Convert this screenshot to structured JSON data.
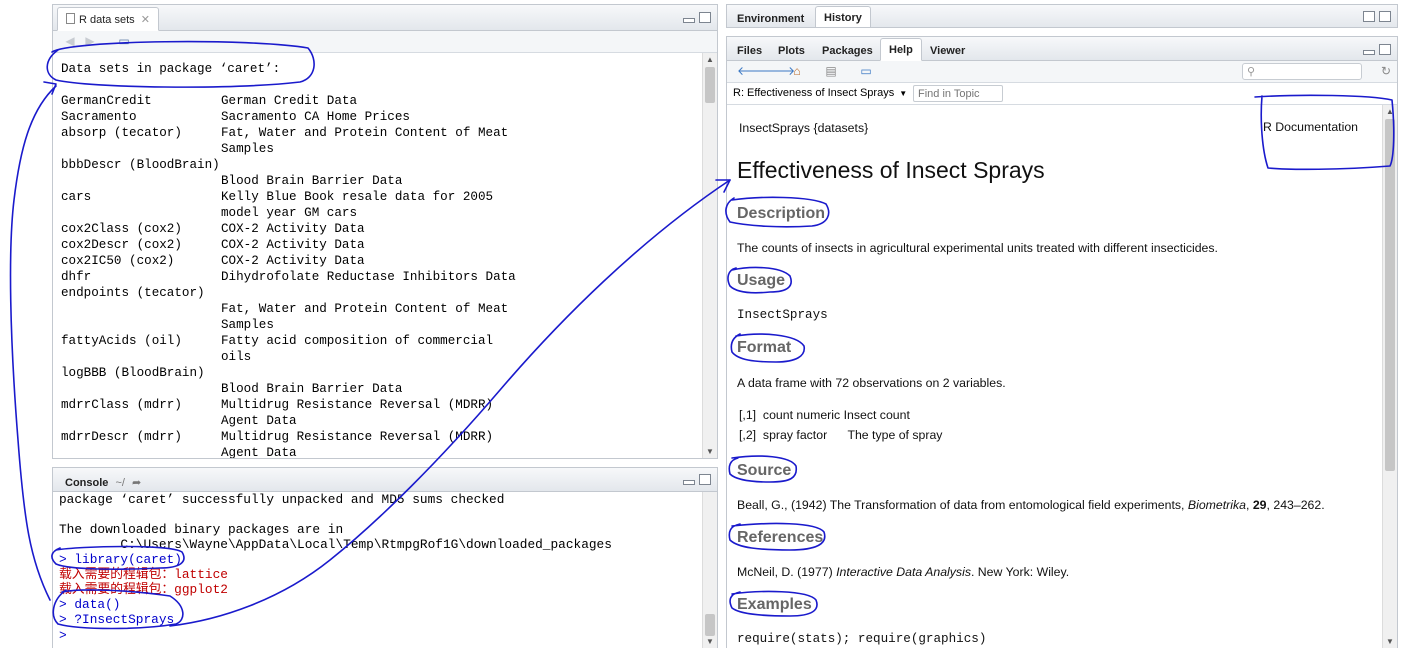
{
  "source_pane": {
    "tab_label": "R data sets",
    "heading": "Data sets in package ‘caret’:",
    "rows": [
      [
        "GermanCredit",
        "German Credit Data"
      ],
      [
        "Sacramento",
        "Sacramento CA Home Prices"
      ],
      [
        "absorp (tecator)",
        "Fat, Water and Protein Content of Meat"
      ],
      [
        "",
        "Samples"
      ],
      [
        "bbbDescr (BloodBrain)",
        ""
      ],
      [
        "",
        "Blood Brain Barrier Data"
      ],
      [
        "cars",
        "Kelly Blue Book resale data for 2005"
      ],
      [
        "",
        "model year GM cars"
      ],
      [
        "cox2Class (cox2)",
        "COX-2 Activity Data"
      ],
      [
        "cox2Descr (cox2)",
        "COX-2 Activity Data"
      ],
      [
        "cox2IC50 (cox2)",
        "COX-2 Activity Data"
      ],
      [
        "dhfr",
        "Dihydrofolate Reductase Inhibitors Data"
      ],
      [
        "endpoints (tecator)",
        ""
      ],
      [
        "",
        "Fat, Water and Protein Content of Meat"
      ],
      [
        "",
        "Samples"
      ],
      [
        "fattyAcids (oil)",
        "Fatty acid composition of commercial"
      ],
      [
        "",
        "oils"
      ],
      [
        "logBBB (BloodBrain)",
        ""
      ],
      [
        "",
        "Blood Brain Barrier Data"
      ],
      [
        "mdrrClass (mdrr)",
        "Multidrug Resistance Reversal (MDRR)"
      ],
      [
        "",
        "Agent Data"
      ],
      [
        "mdrrDescr (mdrr)",
        "Multidrug Resistance Reversal (MDRR)"
      ],
      [
        "",
        "Agent Data"
      ]
    ]
  },
  "console": {
    "tab_label": "Console",
    "path": "~/",
    "lines": [
      {
        "text": "package ‘caret’ successfully unpacked and MD5 sums checked",
        "color": "#000000"
      },
      {
        "text": "",
        "color": "#000000"
      },
      {
        "text": "The downloaded binary packages are in",
        "color": "#000000"
      },
      {
        "text": "        C:\\Users\\Wayne\\AppData\\Local\\Temp\\RtmpgRof1G\\downloaded_packages",
        "color": "#000000"
      },
      {
        "text": "> library(caret)",
        "color": "#0000cc"
      },
      {
        "text": "载入需要的程辑包：lattice",
        "color": "#c00000"
      },
      {
        "text": "载入需要的程辑包：ggplot2",
        "color": "#c00000"
      },
      {
        "text": "> data()",
        "color": "#0000cc"
      },
      {
        "text": "> ?InsectSprays",
        "color": "#0000cc"
      },
      {
        "text": "> ",
        "color": "#0000cc"
      }
    ]
  },
  "env_pane": {
    "tabs": [
      "Environment",
      "History"
    ]
  },
  "help_pane": {
    "tabs": [
      "Files",
      "Plots",
      "Packages",
      "Help",
      "Viewer"
    ],
    "active_tab": "Help",
    "topic_dropdown": "R: Effectiveness of Insect Sprays",
    "find_placeholder": "Find in Topic",
    "doc": {
      "topic": "InsectSprays {datasets}",
      "doc_label": "R Documentation",
      "title": "Effectiveness of Insect Sprays",
      "description_h": "Description",
      "description": "The counts of insects in agricultural experimental units treated with different insecticides.",
      "usage_h": "Usage",
      "usage": "InsectSprays",
      "format_h": "Format",
      "format": "A data frame with 72 observations on 2 variables.",
      "format_row1": "[,1]  count numeric Insect count",
      "format_row2": "[,2]  spray factor      The type of spray",
      "source_h": "Source",
      "source_pre": "Beall, G., (1942) The Transformation of data from entomological field experiments, ",
      "source_journal": "Biometrika",
      "source_sep": ", ",
      "source_vol": "29",
      "source_post": ", 243–262.",
      "references_h": "References",
      "ref_pre": "McNeil, D. (1977) ",
      "ref_title": "Interactive Data Analysis",
      "ref_post": ". New York: Wiley.",
      "examples_h": "Examples",
      "examples": "require(stats); require(graphics)"
    }
  },
  "colors": {
    "annotation_ink": "#1a1acc",
    "heading_gray": "#666666"
  }
}
